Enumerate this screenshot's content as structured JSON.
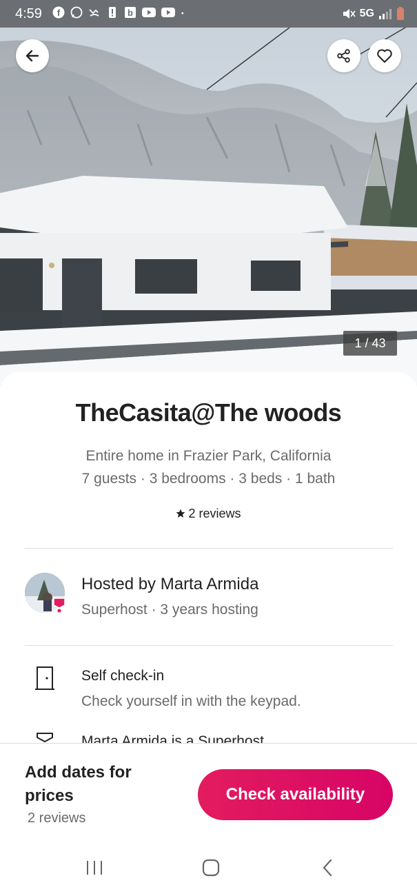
{
  "status_bar": {
    "time": "4:59",
    "network": "5G",
    "left_icons": [
      "facebook-icon",
      "whatsapp-icon",
      "call-missed-icon",
      "alert-icon",
      "b-icon",
      "youtube-icon",
      "youtube-icon",
      "dot-icon"
    ],
    "right_icons": [
      "mute-icon",
      "signal-icon",
      "battery-icon"
    ]
  },
  "hero": {
    "photo_counter": "1 / 43",
    "buttons": [
      "back-icon",
      "share-icon",
      "heart-icon"
    ]
  },
  "listing": {
    "title": "TheCasita@The woods",
    "subtitle": "Entire home in Frazier Park, California",
    "details": "7 guests · 3 bedrooms · 3 beds · 1 bath",
    "reviews": "2 reviews"
  },
  "host": {
    "name": "Hosted by Marta Armida",
    "subtitle": "Superhost · 3 years hosting"
  },
  "features": [
    {
      "icon": "door-icon",
      "title": "Self check-in",
      "description": "Check yourself in with the keypad."
    },
    {
      "icon": "superhost-badge-icon",
      "title": "Marta Armida is a Superhost",
      "description": ""
    }
  ],
  "footer": {
    "price_label": "Add dates for prices",
    "reviews": "2 reviews",
    "cta_label": "Check availability"
  },
  "colors": {
    "accent": "#e31c5f",
    "text_primary": "#222222",
    "text_secondary": "#6a6a6a"
  }
}
